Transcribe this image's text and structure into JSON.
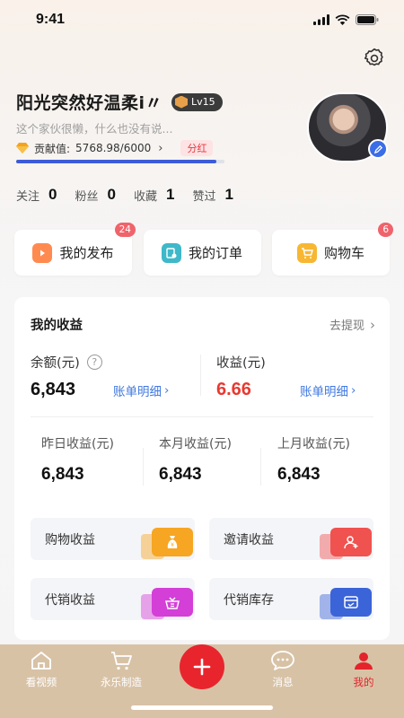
{
  "status_bar": {
    "time": "9:41"
  },
  "profile": {
    "name": "阳光突然好温柔i〃",
    "level": "Lv15",
    "bio": "这个家伙很懒，什么也没有说...",
    "contribution_label": "贡献值:",
    "contribution_value": "5768.98/6000",
    "contribution_progress": 0.96,
    "dividend_label": "分红"
  },
  "stats": [
    {
      "label": "关注",
      "value": "0"
    },
    {
      "label": "粉丝",
      "value": "0"
    },
    {
      "label": "收藏",
      "value": "1"
    },
    {
      "label": "赞过",
      "value": "1"
    }
  ],
  "quick_actions": [
    {
      "label": "我的发布",
      "badge": "24",
      "icon": "video-icon",
      "color": "#ff8a50"
    },
    {
      "label": "我的订单",
      "badge": "",
      "icon": "order-icon",
      "color": "#3fb8c9"
    },
    {
      "label": "购物车",
      "badge": "6",
      "icon": "cart-icon",
      "color": "#f7b733"
    }
  ],
  "earnings": {
    "title": "我的收益",
    "withdraw": "去提现",
    "balance_label": "余额(元)",
    "balance_value": "6,843",
    "balance_link": "账单明细",
    "income_label": "收益(元)",
    "income_value": "6.66",
    "income_link": "账单明细",
    "yesterday_label": "昨日收益(元)",
    "yesterday_value": "6,843",
    "month_label": "本月收益(元)",
    "month_value": "6,843",
    "last_month_label": "上月收益(元)",
    "last_month_value": "6,843"
  },
  "tiles": [
    {
      "label": "购物收益",
      "icon": "money-bag-icon",
      "color": "#f6a623"
    },
    {
      "label": "邀请收益",
      "icon": "invite-user-icon",
      "color": "#f0524f"
    },
    {
      "label": "代销收益",
      "icon": "basket-icon",
      "color": "#d43fd8"
    },
    {
      "label": "代销库存",
      "icon": "inventory-icon",
      "color": "#3b64d8"
    }
  ],
  "tabbar": [
    {
      "label": "看视频",
      "icon": "home-icon",
      "active": false
    },
    {
      "label": "永乐制造",
      "icon": "cart-icon",
      "active": false
    },
    {
      "label": "消息",
      "icon": "chat-icon",
      "active": false
    },
    {
      "label": "我的",
      "icon": "user-icon",
      "active": true
    }
  ],
  "colors": {
    "accent_red": "#e8252d",
    "link_blue": "#3f78e0",
    "progress_blue": "#3d5bd8",
    "tabbar_bg": "#d8c2a6"
  }
}
